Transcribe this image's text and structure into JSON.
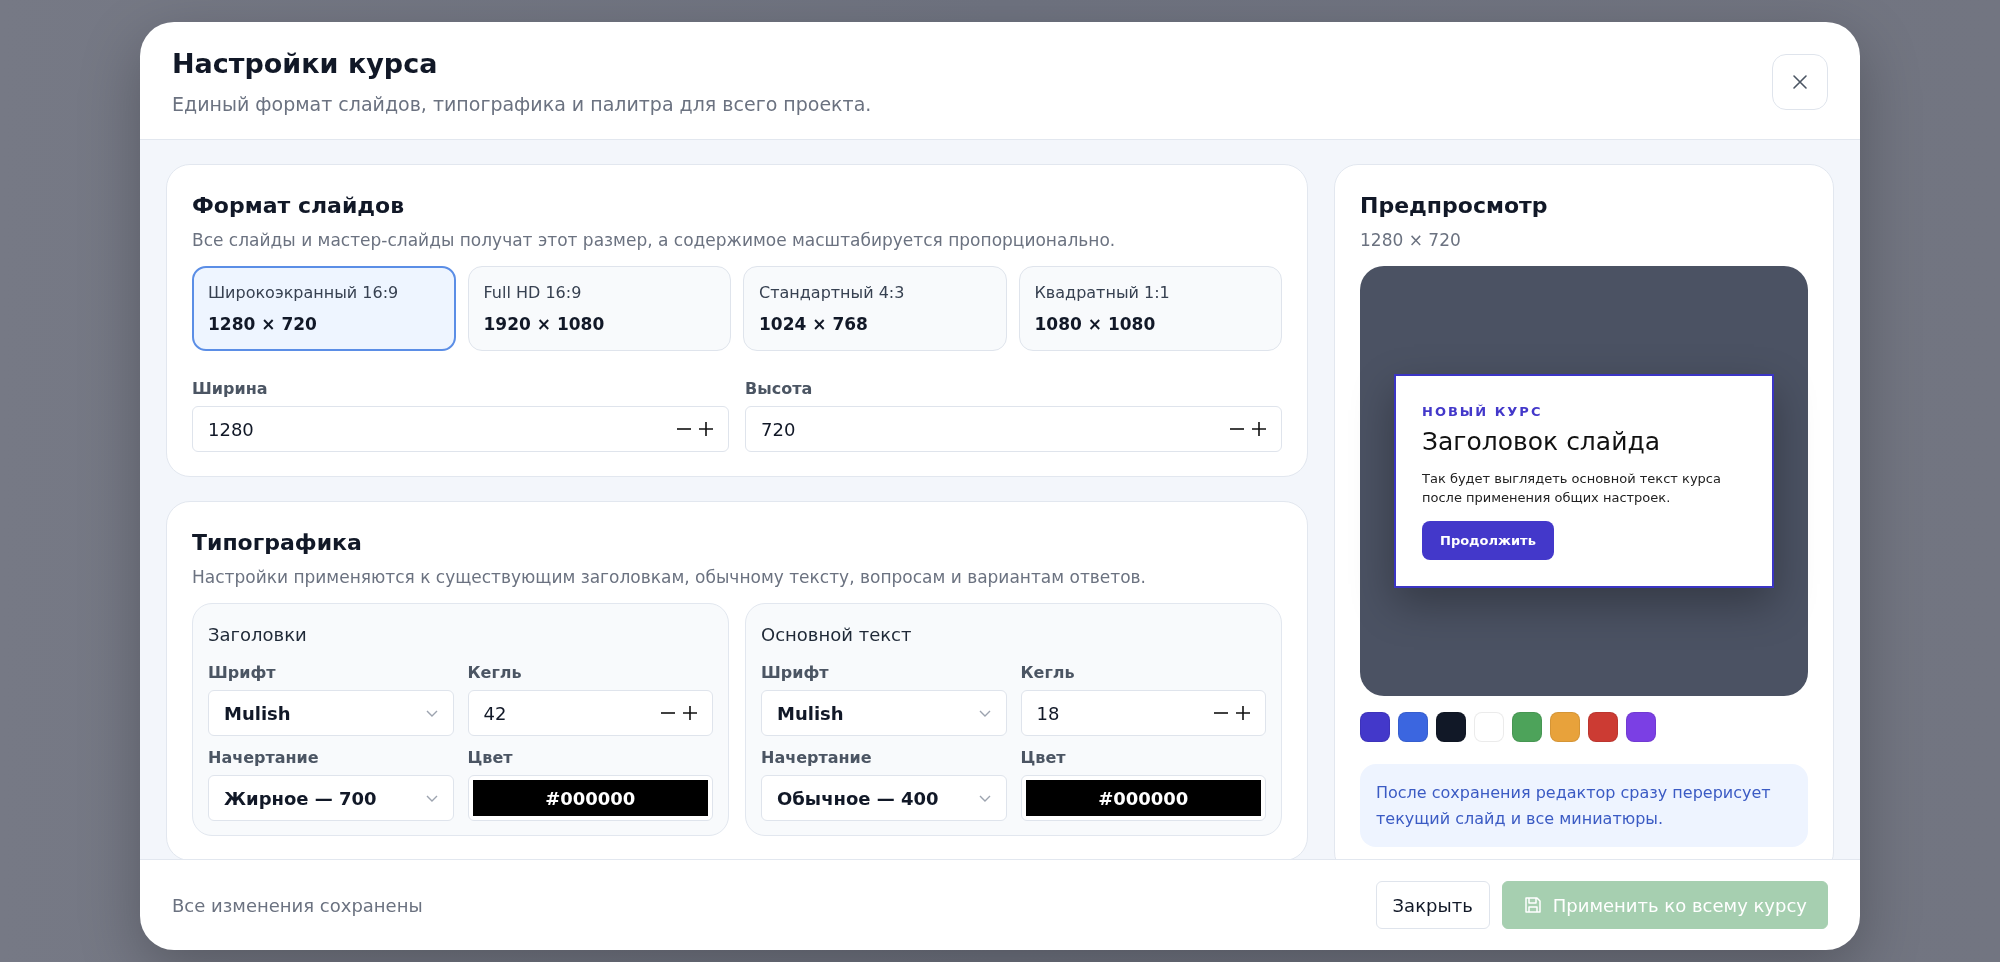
{
  "dialog": {
    "title": "Настройки курса",
    "subtitle": "Единый формат слайдов, типографика и палитра для всего проекта."
  },
  "slide_format": {
    "title": "Формат слайдов",
    "description": "Все слайды и мастер-слайды получат этот размер, а содержимое масштабируется пропорционально.",
    "presets": [
      {
        "name": "Широкоэкранный 16:9",
        "size": "1280 × 720",
        "selected": true
      },
      {
        "name": "Full HD 16:9",
        "size": "1920 × 1080",
        "selected": false
      },
      {
        "name": "Стандартный 4:3",
        "size": "1024 × 768",
        "selected": false
      },
      {
        "name": "Квадратный 1:1",
        "size": "1080 × 1080",
        "selected": false
      }
    ],
    "fields": [
      {
        "label": "Ширина",
        "value": "1280"
      },
      {
        "label": "Высота",
        "value": "720"
      }
    ]
  },
  "typography": {
    "title": "Типографика",
    "description": "Настройки применяются к существующим заголовкам, обычному тексту, вопросам и вариантам ответов.",
    "groups": [
      {
        "title": "Заголовки",
        "font": {
          "label": "Шрифт",
          "value": "Mulish"
        },
        "size": {
          "label": "Кегль",
          "value": "42"
        },
        "weight": {
          "label": "Начертание",
          "value": "Жирное — 700"
        },
        "color": {
          "label": "Цвет",
          "value": "#000000"
        }
      },
      {
        "title": "Основной текст",
        "font": {
          "label": "Шрифт",
          "value": "Mulish"
        },
        "size": {
          "label": "Кегль",
          "value": "18"
        },
        "weight": {
          "label": "Начертание",
          "value": "Обычное — 400"
        },
        "color": {
          "label": "Цвет",
          "value": "#000000"
        }
      }
    ]
  },
  "preview": {
    "title": "Предпросмотр",
    "size": "1280 × 720",
    "slide": {
      "eyebrow": "НОВЫЙ КУРС",
      "heading": "Заголовок слайда",
      "body": "Так будет выглядеть основной текст курса после применения общих настроек.",
      "button": "Продолжить"
    },
    "palette": [
      {
        "color": "#4338ca"
      },
      {
        "color": "#3b66e0"
      },
      {
        "color": "#111827"
      },
      {
        "color": "#ffffff"
      },
      {
        "color": "#4da35a"
      },
      {
        "color": "#e8a23b"
      },
      {
        "color": "#cc3b33"
      },
      {
        "color": "#7b3fe4"
      }
    ],
    "note": "После сохранения редактор сразу перерисует текущий слайд и все миниатюры."
  },
  "footer": {
    "status": "Все изменения сохранены",
    "close_button": "Закрыть",
    "apply_button": {
      "label": "Применить ко всему курсу",
      "disabled": true
    }
  }
}
